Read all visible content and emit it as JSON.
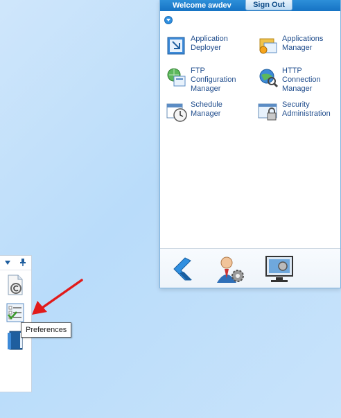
{
  "header": {
    "welcome": "Welcome awdev",
    "sign_out": "Sign Out"
  },
  "apps": [
    {
      "label_lines": [
        "Application",
        "Deployer"
      ],
      "icon": "application-deployer-icon"
    },
    {
      "label_lines": [
        "Applications",
        "Manager"
      ],
      "icon": "applications-manager-icon"
    },
    {
      "label_lines": [
        "FTP",
        "Configuration",
        "Manager"
      ],
      "icon": "ftp-configuration-icon"
    },
    {
      "label_lines": [
        "HTTP",
        "Connection",
        "Manager"
      ],
      "icon": "http-connection-icon"
    },
    {
      "label_lines": [
        "Schedule",
        "Manager"
      ],
      "icon": "schedule-manager-icon"
    },
    {
      "label_lines": [
        "Security",
        "Administration"
      ],
      "icon": "security-administration-icon"
    }
  ],
  "bottom_icons": [
    "logo-icon",
    "user-settings-icon",
    "monitor-settings-icon"
  ],
  "sidebar": {
    "icons": [
      "copyright-document-icon",
      "preferences-icon",
      "book-icon"
    ]
  },
  "tooltip": {
    "text": "Preferences"
  },
  "colors": {
    "header_blue": "#1a7ccc",
    "link_blue": "#1f4c8c",
    "arrow_red": "#e11b1b"
  }
}
